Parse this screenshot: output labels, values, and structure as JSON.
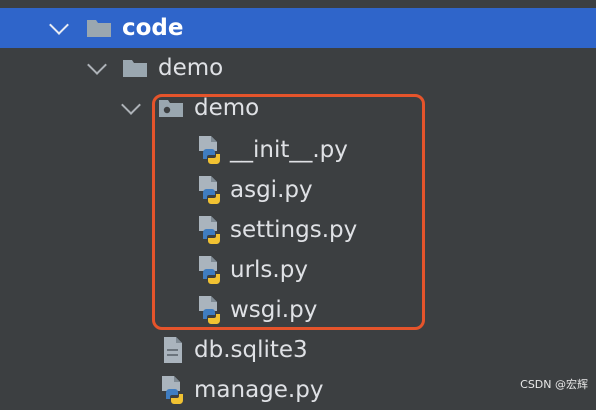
{
  "tree": {
    "items": [
      {
        "label": "code",
        "type": "folder",
        "expanded": true,
        "selected": true
      },
      {
        "label": "demo",
        "type": "folder",
        "expanded": true
      },
      {
        "label": "demo",
        "type": "package",
        "expanded": true
      },
      {
        "label": "__init__.py",
        "type": "python"
      },
      {
        "label": "asgi.py",
        "type": "python"
      },
      {
        "label": "settings.py",
        "type": "python"
      },
      {
        "label": "urls.py",
        "type": "python"
      },
      {
        "label": "wsgi.py",
        "type": "python"
      },
      {
        "label": "db.sqlite3",
        "type": "file"
      },
      {
        "label": "manage.py",
        "type": "python"
      }
    ]
  },
  "watermark": "CSDN @宏辉",
  "colors": {
    "background": "#3c3f41",
    "selection": "#2f65ca",
    "highlight_border": "#e5542b",
    "folder": "#9aa7b0",
    "python_blue": "#3f7dc1",
    "python_yellow": "#f1c232"
  }
}
